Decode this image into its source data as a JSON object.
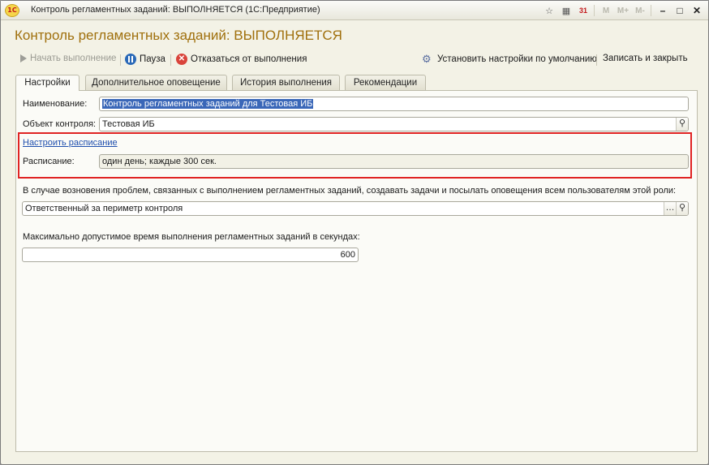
{
  "window": {
    "title": "Контроль регламентных заданий: ВЫПОЛНЯЕТСЯ  (1С:Предприятие)",
    "logo_text": "1C",
    "toolbar_icons": [
      "favorites-icon",
      "calculator-icon",
      "calendar-icon",
      "M",
      "M+",
      "M-",
      "minimize-icon",
      "maximize-icon",
      "close-icon"
    ],
    "mem_labels": [
      "M",
      "M+",
      "M-"
    ],
    "calendar_day": "31"
  },
  "form": {
    "title": "Контроль регламентных заданий: ВЫПОЛНЯЕТСЯ"
  },
  "commands": {
    "start": "Начать выполнение",
    "pause": "Пауза",
    "cancel": "Отказаться от выполнения",
    "defaults": "Установить настройки по умолчанию",
    "save_close": "Записать и закрыть"
  },
  "tabs": [
    {
      "label": "Настройки",
      "active": true
    },
    {
      "label": "Дополнительное оповещение",
      "active": false
    },
    {
      "label": "История выполнения",
      "active": false
    },
    {
      "label": "Рекомендации",
      "active": false
    }
  ],
  "fields": {
    "name_label": "Наименование:",
    "name_value": "Контроль регламентных заданий для Тестовая ИБ",
    "object_label": "Объект контроля:",
    "object_value": "Тестовая ИБ",
    "schedule_link": "Настроить расписание",
    "schedule_label": "Расписание:",
    "schedule_value": "один день; каждые 300 сек.",
    "role_prompt": "В случае возновения проблем, связанных с выполнением регламентных заданий, создавать задачи и посылать оповещения всем пользователям этой роли:",
    "role_value": "Ответственный за периметр контроля",
    "max_time_label": "Максимально допустимое время выполнения регламентных заданий в секундах:",
    "max_time_value": "600"
  },
  "colors": {
    "title_accent": "#a0700d",
    "highlight_border": "#e02323",
    "link": "#1f4fae"
  }
}
